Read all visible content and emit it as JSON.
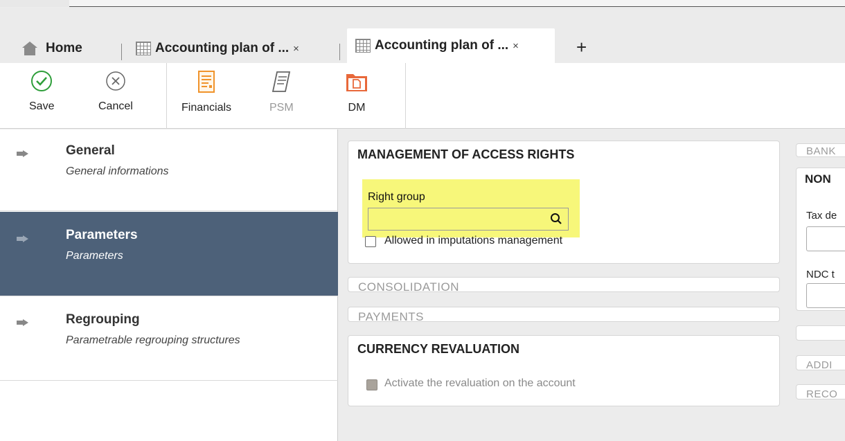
{
  "tabs": {
    "home": "Home",
    "tab1": "Accounting plan of ...",
    "tab2": "Accounting plan of ...",
    "close": "×",
    "add": "+"
  },
  "toolbar": {
    "save": "Save",
    "cancel": "Cancel",
    "financials": "Financials",
    "psm": "PSM",
    "dm": "DM"
  },
  "sidebar": {
    "items": [
      {
        "title": "General",
        "subtitle": "General informations"
      },
      {
        "title": "Parameters",
        "subtitle": "Parameters"
      },
      {
        "title": "Regrouping",
        "subtitle": "Parametrable regrouping structures"
      }
    ]
  },
  "access_rights": {
    "title": "MANAGEMENT OF ACCESS RIGHTS",
    "right_group_label": "Right group",
    "right_group_value": "",
    "allowed_label": "Allowed in imputations management"
  },
  "sections": {
    "consolidation": "CONSOLIDATION",
    "payments": "PAYMENTS"
  },
  "currency_revaluation": {
    "title": "CURRENCY REVALUATION",
    "activate_label": "Activate the revaluation on the account"
  },
  "right_column": {
    "bank": "BANK",
    "non": "NON",
    "tax_label": "Tax de",
    "ndc_label": "NDC t",
    "addi": "ADDI",
    "reco": "RECO"
  },
  "colors": {
    "active_nav": "#4d6179",
    "highlight": "#f7f77a",
    "save_green": "#2e9e3a",
    "financials_orange": "#f0932b",
    "dm_orange": "#e8683a"
  }
}
